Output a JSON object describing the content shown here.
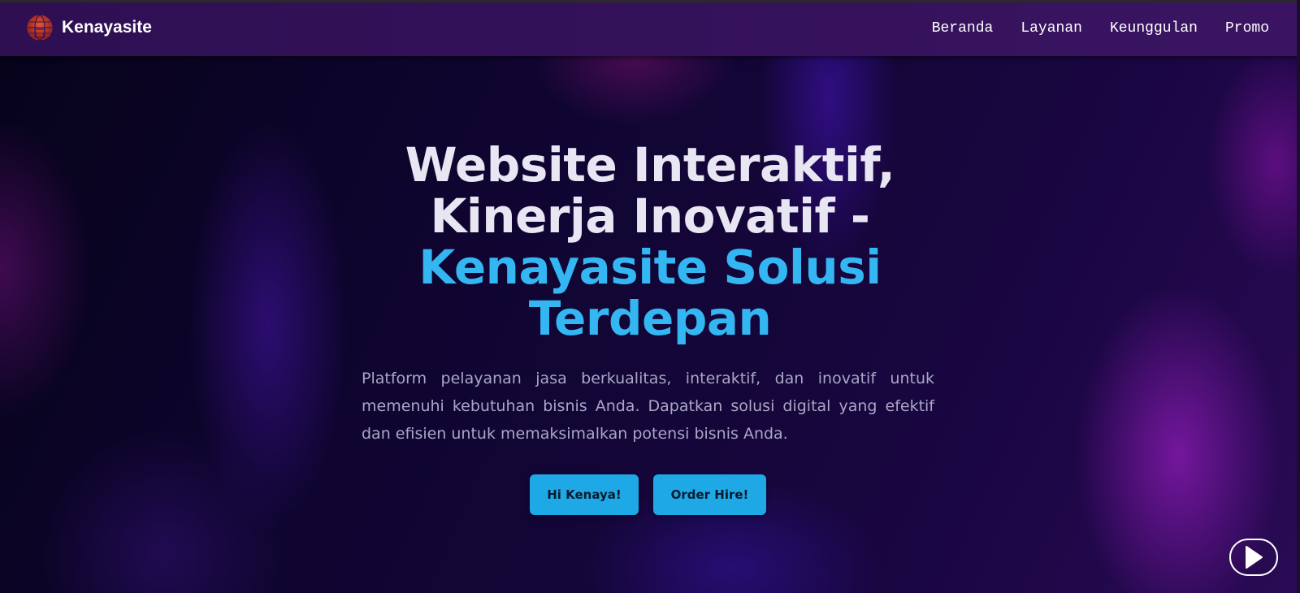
{
  "navbar": {
    "brand_name": "Kenayasite",
    "logo_icon": "globe-logo-icon",
    "links": [
      {
        "label": "Beranda"
      },
      {
        "label": "Layanan"
      },
      {
        "label": "Keunggulan"
      },
      {
        "label": "Promo"
      }
    ]
  },
  "hero": {
    "headline_line1": "Website Interaktif,",
    "headline_line2": "Kinerja Inovatif -",
    "headline_accent_line1": "Kenayasite Solusi",
    "headline_accent_line2": "Terdepan",
    "description": "Platform pelayanan jasa berkualitas, interaktif, dan inovatif untuk memenuhi kebutuhan bisnis Anda. Dapatkan solusi digital yang efektif dan efisien untuk memaksimalkan potensi bisnis Anda.",
    "buttons": {
      "primary_label": "Hi Kenaya!",
      "secondary_label": "Order Hire!"
    },
    "play_icon": "play-icon"
  },
  "colors": {
    "accent": "#33b6f2",
    "button": "#1ea9e6",
    "navbar": "#3a1462",
    "headline": "#e9e6f4",
    "body_text": "#a9a7c7"
  }
}
